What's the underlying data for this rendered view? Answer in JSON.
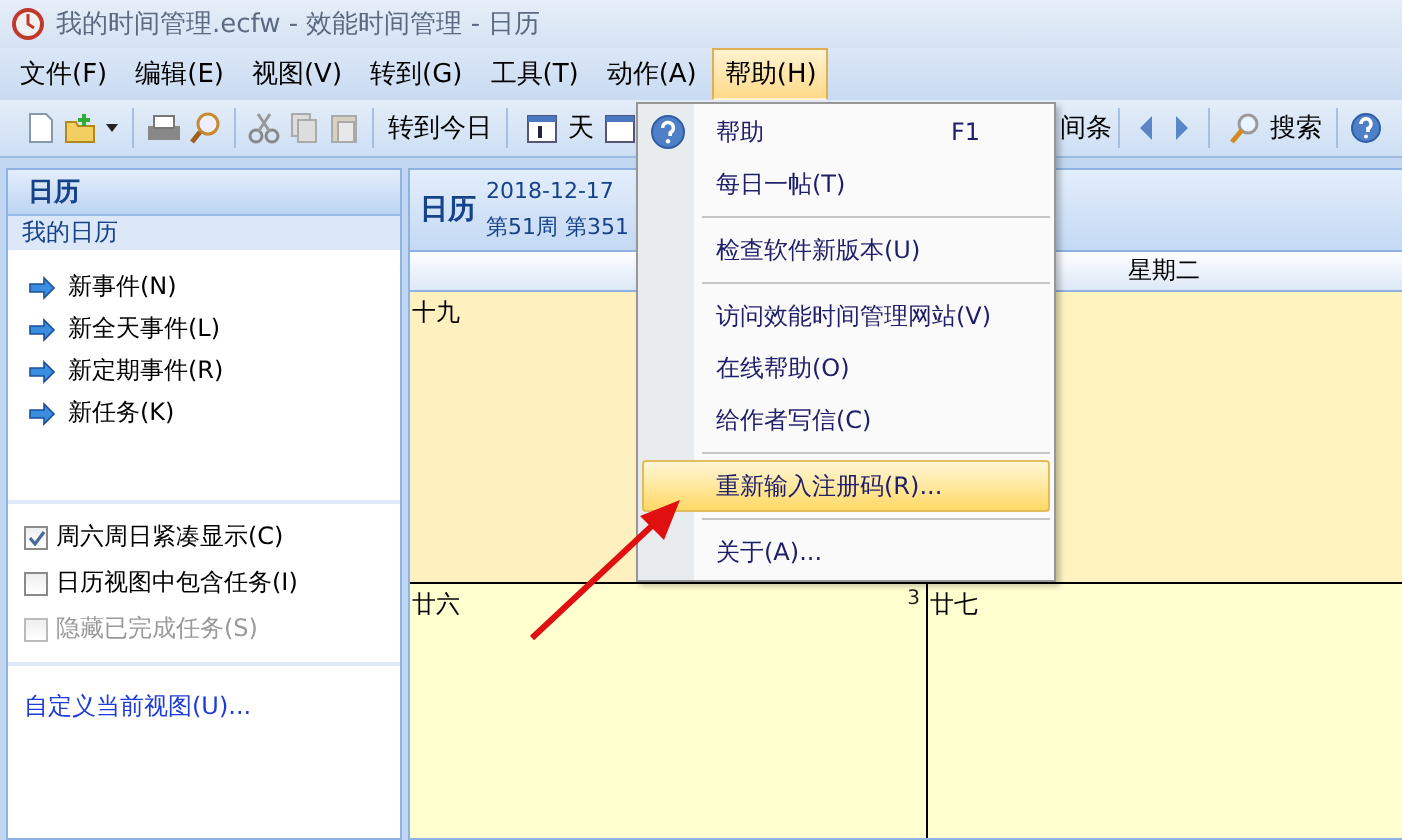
{
  "window": {
    "title": "我的时间管理.ecfw - 效能时间管理 - 日历"
  },
  "menu_bar": [
    {
      "label": "文件(F)",
      "selected": false
    },
    {
      "label": "编辑(E)",
      "selected": false
    },
    {
      "label": "视图(V)",
      "selected": false
    },
    {
      "label": "转到(G)",
      "selected": false
    },
    {
      "label": "工具(T)",
      "selected": false
    },
    {
      "label": "动作(A)",
      "selected": false
    },
    {
      "label": "帮助(H)",
      "selected": true
    }
  ],
  "toolbar": {
    "today": "转到今日",
    "day": "天",
    "cut_off_button": "间条",
    "search": "搜索"
  },
  "sidebar": {
    "title": "日历",
    "section": "我的日历",
    "actions": [
      "新事件(N)",
      "新全天事件(L)",
      "新定期事件(R)",
      "新任务(K)"
    ],
    "options": [
      {
        "label": "周六周日紧凑显示(C)",
        "checked": true,
        "disabled": false
      },
      {
        "label": "日历视图中包含任务(I)",
        "checked": false,
        "disabled": false
      },
      {
        "label": "隐藏已完成任务(S)",
        "checked": false,
        "disabled": true
      }
    ],
    "link": "自定义当前视图(U)..."
  },
  "calendar": {
    "title": "日历",
    "date_line": "2018-12-17",
    "week_line": "第51周 第351",
    "columns": [
      "星期二"
    ],
    "weeks": [
      {
        "current": true,
        "days": [
          {
            "label": "十九"
          }
        ]
      },
      {
        "current": false,
        "days": [
          {
            "label": "廿六",
            "corner": "3"
          },
          {
            "label": "廿七"
          }
        ]
      }
    ]
  },
  "help_menu": {
    "items": [
      {
        "kind": "item",
        "label": "帮助",
        "shortcut": "F1",
        "selected": false
      },
      {
        "kind": "item",
        "label": "每日一帖(T)",
        "selected": false
      },
      {
        "kind": "separator"
      },
      {
        "kind": "item",
        "label": "检查软件新版本(U)",
        "selected": false
      },
      {
        "kind": "separator"
      },
      {
        "kind": "item",
        "label": "访问效能时间管理网站(V)",
        "selected": false
      },
      {
        "kind": "item",
        "label": "在线帮助(O)",
        "selected": false
      },
      {
        "kind": "item",
        "label": "给作者写信(C)",
        "selected": false
      },
      {
        "kind": "separator"
      },
      {
        "kind": "item",
        "label": "重新输入注册码(R)...",
        "selected": true
      },
      {
        "kind": "separator"
      },
      {
        "kind": "item",
        "label": "关于(A)...",
        "selected": false
      }
    ]
  }
}
